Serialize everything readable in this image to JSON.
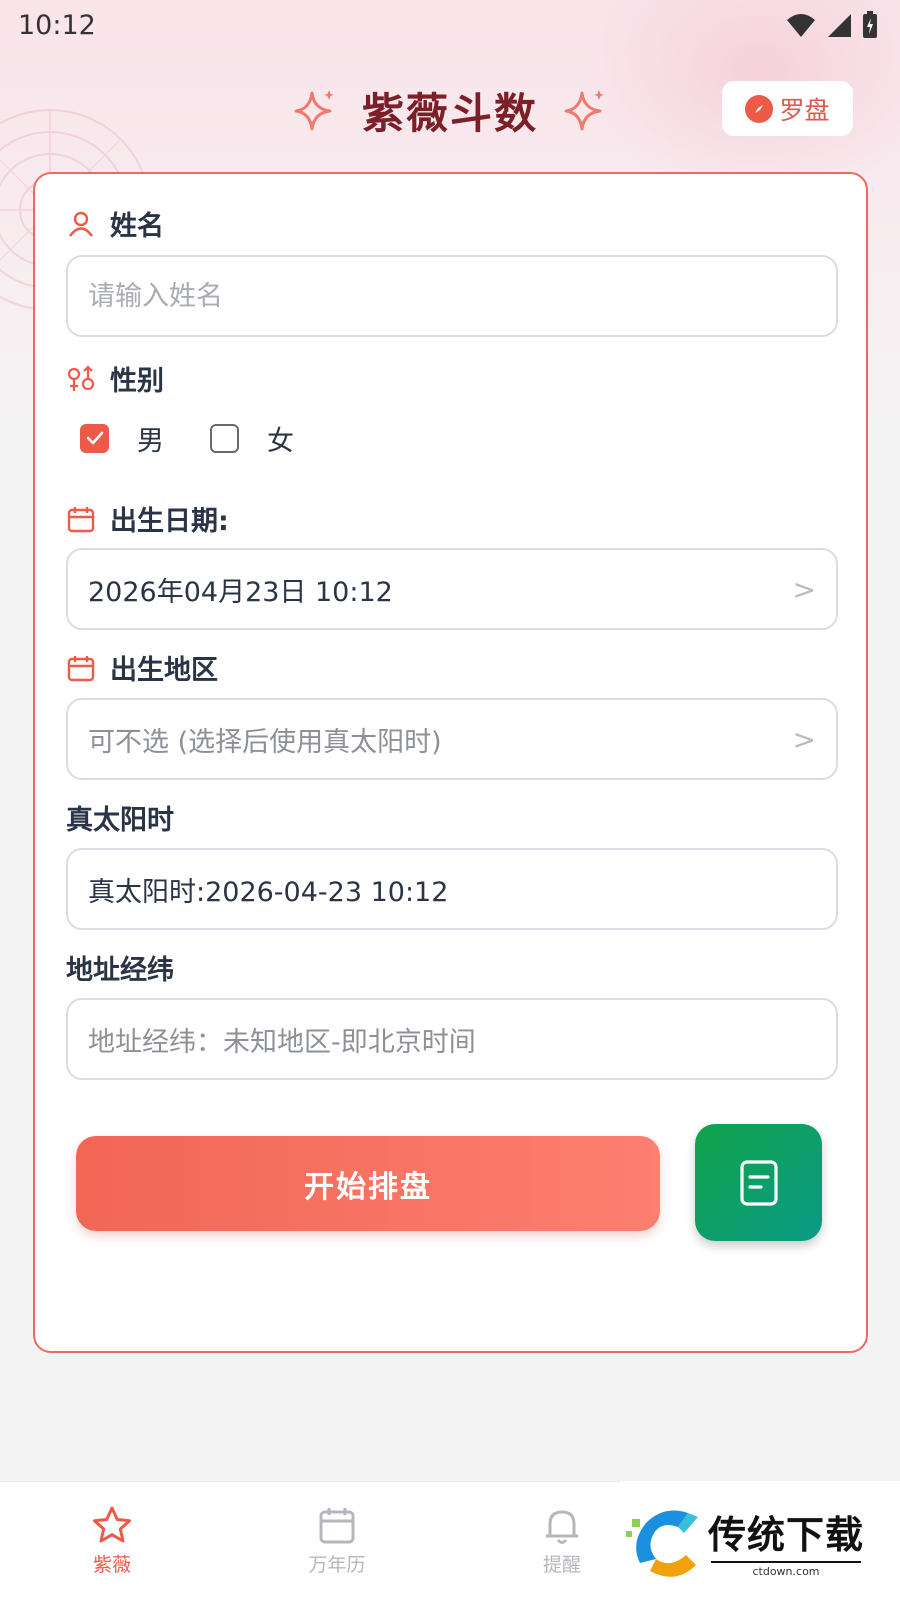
{
  "status_bar": {
    "time": "10:12"
  },
  "header": {
    "title": "紫薇斗数",
    "compass_label": "罗盘"
  },
  "form": {
    "name": {
      "label": "姓名",
      "placeholder": "请输入姓名"
    },
    "gender": {
      "label": "性别",
      "male": "男",
      "female": "女",
      "selected": "男"
    },
    "birth_date": {
      "label": "出生日期:",
      "value": "2026年04月23日 10:12"
    },
    "birth_region": {
      "label": "出生地区",
      "placeholder": "可不选 (选择后使用真太阳时)"
    },
    "true_solar_time": {
      "label": "真太阳时",
      "value": "真太阳时:2026-04-23 10:12"
    },
    "address_coords": {
      "label": "地址经纬",
      "placeholder": "地址经纬：未知地区-即北京时间"
    },
    "start_button": "开始排盘"
  },
  "bottom_nav": {
    "items": [
      {
        "label": "紫薇",
        "icon": "star-icon",
        "active": true
      },
      {
        "label": "万年历",
        "icon": "calendar-icon",
        "active": false
      },
      {
        "label": "提醒",
        "icon": "bell-icon",
        "active": false
      }
    ]
  },
  "watermark": {
    "title": "传统下载",
    "url": "ctdown.com"
  },
  "colors": {
    "accent": "#ee5a48",
    "title": "#7b1f28",
    "green": "#10a44a"
  }
}
